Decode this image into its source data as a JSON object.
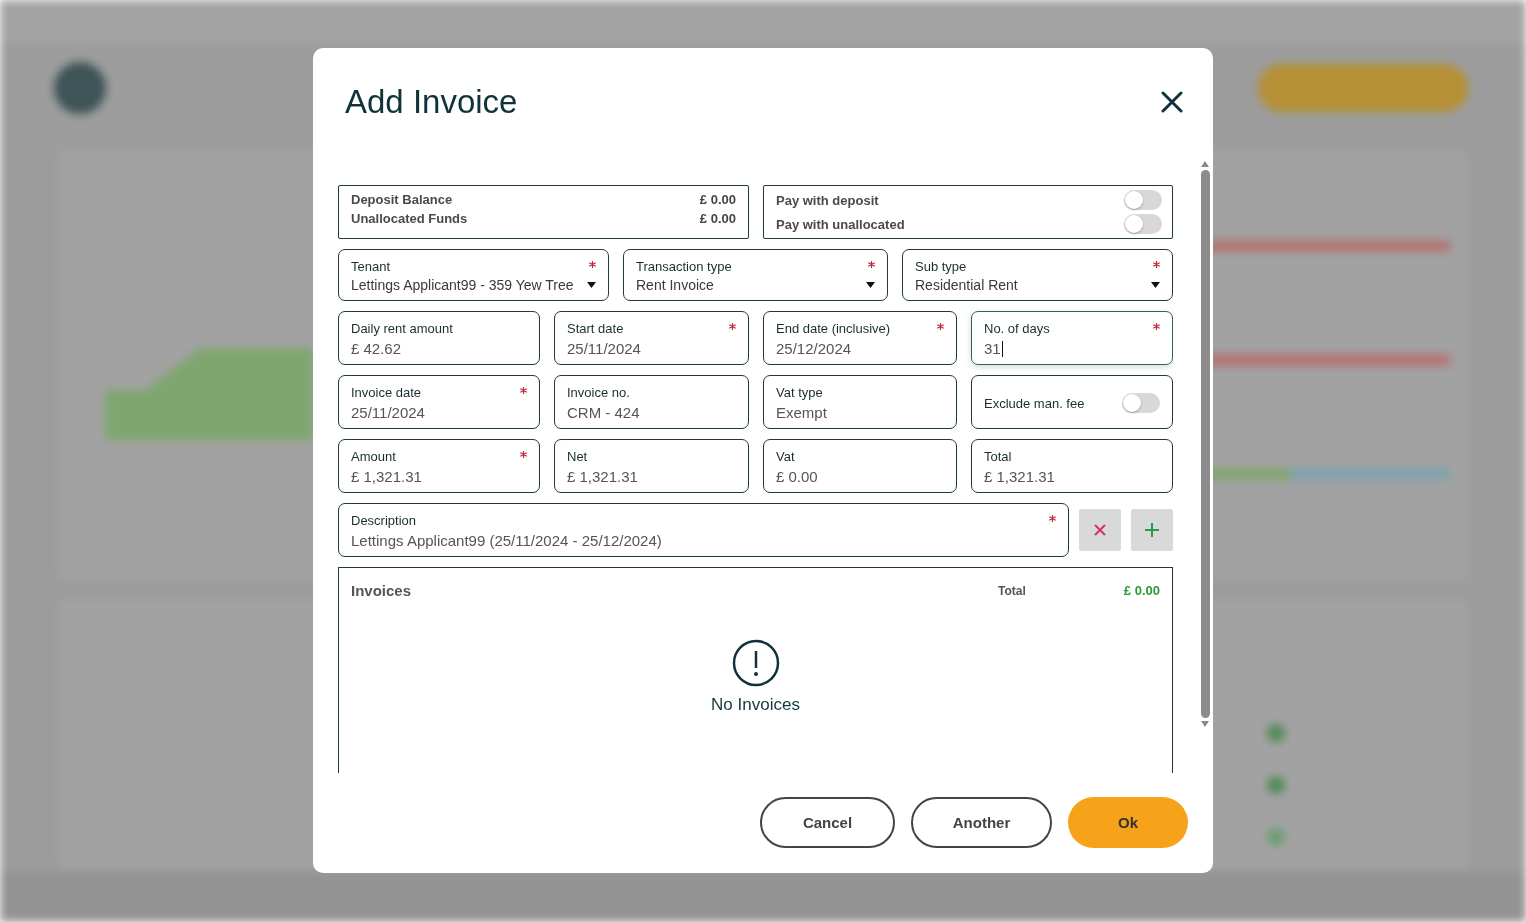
{
  "dialog": {
    "title": "Add Invoice"
  },
  "balances": [
    {
      "label": "Deposit Balance",
      "value": "£ 0.00"
    },
    {
      "label": "Unallocated Funds",
      "value": "£ 0.00"
    }
  ],
  "payment_options": [
    {
      "label": "Pay with deposit",
      "on": false
    },
    {
      "label": "Pay with unallocated",
      "on": false
    }
  ],
  "selects": [
    {
      "label": "Tenant",
      "value": "Lettings Applicant99 - 359 Yew Tree",
      "required": true
    },
    {
      "label": "Transaction type",
      "value": "Rent Invoice",
      "required": true
    },
    {
      "label": "Sub type",
      "value": "Residential Rent",
      "required": true
    }
  ],
  "field_rows": [
    [
      {
        "kind": "text",
        "label": "Daily rent amount",
        "value": "£ 42.62",
        "required": false,
        "focused": false
      },
      {
        "kind": "text",
        "label": "Start date",
        "value": "25/11/2024",
        "required": true,
        "focused": false
      },
      {
        "kind": "text",
        "label": "End date (inclusive)",
        "value": "25/12/2024",
        "required": true,
        "focused": false
      },
      {
        "kind": "text",
        "label": "No. of days",
        "value": "31",
        "required": true,
        "focused": true
      }
    ],
    [
      {
        "kind": "text",
        "label": "Invoice date",
        "value": "25/11/2024",
        "required": true,
        "focused": false
      },
      {
        "kind": "text",
        "label": "Invoice no.",
        "value": "CRM - 424",
        "required": false,
        "focused": false
      },
      {
        "kind": "text",
        "label": "Vat type",
        "value": "Exempt",
        "required": false,
        "focused": false
      },
      {
        "kind": "toggle",
        "label": "Exclude man. fee",
        "on": false
      }
    ],
    [
      {
        "kind": "text",
        "label": "Amount",
        "value": "£ 1,321.31",
        "required": true,
        "focused": false
      },
      {
        "kind": "text",
        "label": "Net",
        "value": "£ 1,321.31",
        "required": false,
        "focused": false
      },
      {
        "kind": "text",
        "label": "Vat",
        "value": "£ 0.00",
        "required": false,
        "focused": false
      },
      {
        "kind": "text",
        "label": "Total",
        "value": "£ 1,321.31",
        "required": false,
        "focused": false
      }
    ]
  ],
  "description": {
    "label": "Description",
    "value": "Lettings Applicant99 (25/11/2024 - 25/12/2024)",
    "required": true
  },
  "invoices": {
    "title": "Invoices",
    "total_label": "Total",
    "total": "£ 0.00",
    "empty_message": "No Invoices"
  },
  "buttons": [
    {
      "label": "Cancel",
      "kind": "secondary"
    },
    {
      "label": "Another",
      "kind": "secondary"
    },
    {
      "label": "Ok",
      "kind": "primary"
    }
  ]
}
